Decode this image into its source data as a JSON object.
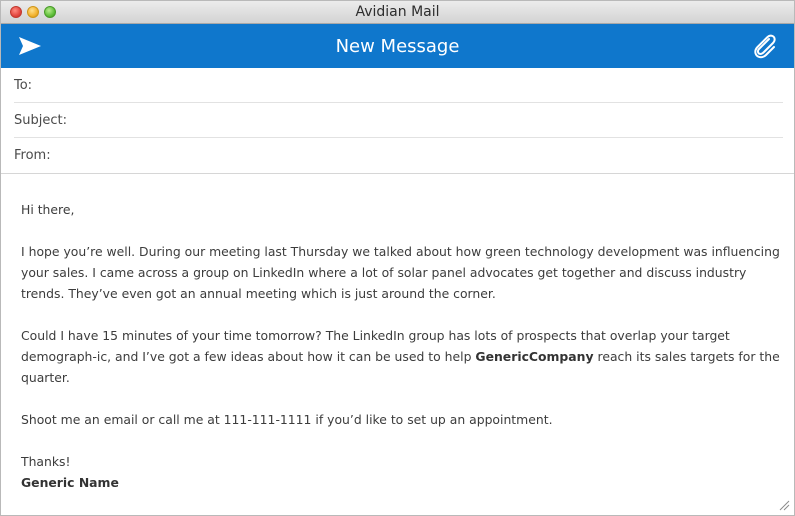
{
  "window": {
    "title": "Avidian Mail"
  },
  "header": {
    "title": "New Message",
    "send_icon": "send-icon",
    "attach_icon": "paperclip-icon",
    "accent_color": "#0f77cc"
  },
  "fields": {
    "to_label": "To:",
    "to_value": "",
    "subject_label": "Subject:",
    "subject_value": "",
    "from_label": "From:",
    "from_value": ""
  },
  "message": {
    "greeting": "Hi there,",
    "p1": "I hope you’re well. During our meeting last Thursday we talked about how green technology development was influencing your sales. I came across a group on LinkedIn where a lot of solar panel advocates get together and discuss industry trends. They’ve even got an annual meeting which is just around the corner.",
    "p2_before": "Could I have 15 minutes of your time tomorrow? The LinkedIn group has lots of prospects that overlap your target demograph-ic, and I’ve got a few ideas about how it can be used to help ",
    "p2_company": "GenericCompany",
    "p2_after": " reach its sales targets for the quarter.",
    "p3": "Shoot me an email or call me at 111-111-1111 if you’d like to set up an appointment.",
    "closing": "Thanks!",
    "signature": "Generic Name"
  }
}
